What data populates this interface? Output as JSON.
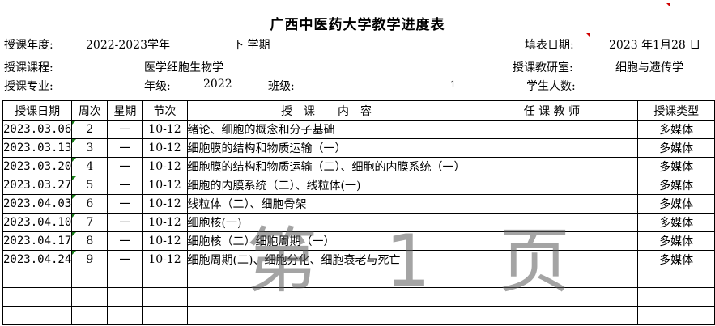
{
  "header": {
    "title": "广西中医药大学教学进度表",
    "year_label": "授课年度:",
    "year_value": "2022-2023学年",
    "semester": "下 学期",
    "fill_date_label": "填表日期:",
    "fill_date_value": "2023 年1月28 日",
    "course_label": "授课课程:",
    "course_value": "医学细胞生物学",
    "dept_label": "授课教研室:",
    "dept_value": "细胞与遗传学",
    "major_label": "授课专业:",
    "grade_label": "年级:",
    "grade_value": "2022",
    "class_label": "班级:",
    "class_value": "1",
    "students_label": "学生人数:"
  },
  "table": {
    "columns": [
      "授课日期",
      "周次",
      "星期",
      "节次",
      "授　课　　内　容",
      "任 课 教 师",
      "授课类型"
    ],
    "rows": [
      {
        "date": "2023.03.06",
        "week": "2",
        "day": "一",
        "period": "10-12",
        "content": "绪论、细胞的概念和分子基础",
        "teacher": "",
        "type": "多媒体"
      },
      {
        "date": "2023.03.13",
        "week": "3",
        "day": "一",
        "period": "10-12",
        "content": "细胞膜的结构和物质运输（一）",
        "teacher": "",
        "type": "多媒体"
      },
      {
        "date": "2023.03.20",
        "week": "4",
        "day": "一",
        "period": "10-12",
        "content": "细胞膜的结构和物质运输（二）、细胞的内膜系统（一）",
        "teacher": "",
        "type": "多媒体"
      },
      {
        "date": "2023.03.27",
        "week": "5",
        "day": "一",
        "period": "10-12",
        "content": "细胞的内膜系统（二）、线粒体(一)",
        "teacher": "",
        "type": "多媒体"
      },
      {
        "date": "2023.04.03",
        "week": "6",
        "day": "一",
        "period": "10-12",
        "content": "线粒体（二）、细胞骨架",
        "teacher": "",
        "type": "多媒体"
      },
      {
        "date": "2023.04.10",
        "week": "7",
        "day": "一",
        "period": "10-12",
        "content": "细胞核(一)",
        "teacher": "",
        "type": "多媒体"
      },
      {
        "date": "2023.04.17",
        "week": "8",
        "day": "一",
        "period": "10-12",
        "content": "细胞核（二）细胞周期（一）",
        "teacher": "",
        "type": "多媒体"
      },
      {
        "date": "2023.04.24",
        "week": "9",
        "day": "一",
        "period": "10-12",
        "content": "细胞周期(二)、细胞分化、细胞衰老与死亡",
        "teacher": "",
        "type": "多媒体"
      }
    ]
  },
  "watermark": "第 1 页",
  "colors": {
    "comment_marker": "#d00000",
    "note_marker": "#1a7f1a"
  }
}
